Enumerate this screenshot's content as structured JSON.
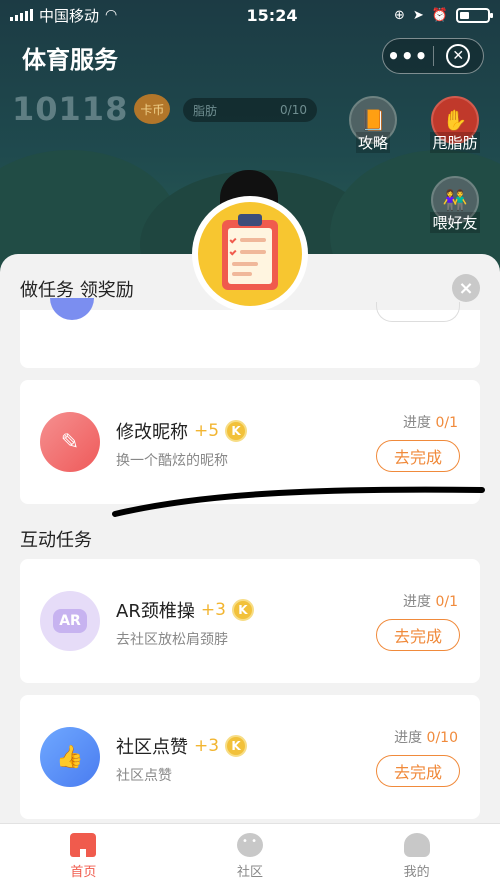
{
  "status_bar": {
    "carrier": "中国移动",
    "time": "15:24"
  },
  "app": {
    "title": "体育服务",
    "more_label": "•••",
    "close_label": "✕"
  },
  "game": {
    "coins": "10118",
    "coin_unit": "卡币",
    "fat_label": "脂肪",
    "fat_progress": "0/10",
    "side_buttons": [
      {
        "label": "攻略"
      },
      {
        "label": "甩脂肪"
      },
      {
        "label": "喂好友"
      }
    ]
  },
  "sheet": {
    "title": "做任务 领奖励",
    "close_label": "×",
    "tasks": [
      {
        "name": "修改昵称",
        "reward": "+5",
        "coin": "K",
        "desc": "换一个酷炫的昵称",
        "progress_label": "进度",
        "progress": "0/1",
        "button": "去完成"
      }
    ],
    "interactive_section_title": "互动任务",
    "interactive_tasks": [
      {
        "name": "AR颈椎操",
        "reward": "+3",
        "coin": "K",
        "desc": "去社区放松肩颈脖",
        "progress_label": "进度",
        "progress": "0/1",
        "button": "去完成",
        "icon_text": "AR"
      },
      {
        "name": "社区点赞",
        "reward": "+3",
        "coin": "K",
        "desc": "社区点赞",
        "progress_label": "进度",
        "progress": "0/10",
        "button": "去完成",
        "icon_text": "👍"
      }
    ]
  },
  "tabbar": {
    "tabs": [
      {
        "label": "首页"
      },
      {
        "label": "社区"
      },
      {
        "label": "我的"
      }
    ]
  },
  "colors": {
    "accent": "#f08a3b",
    "active_tab": "#f05b4d",
    "reward": "#f2b531"
  }
}
